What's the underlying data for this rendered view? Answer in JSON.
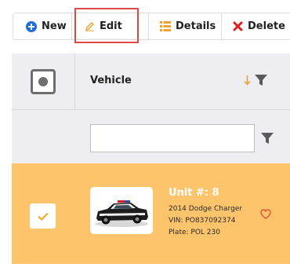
{
  "toolbar": {
    "new_label": "New",
    "edit_label": "Edit",
    "details_label": "Details",
    "delete_label": "Delete",
    "highlighted": "edit"
  },
  "grid": {
    "column_title": "Vehicle",
    "sort_direction": "descending",
    "filter_value": "",
    "filter_placeholder": "",
    "rows": [
      {
        "selected": true,
        "unit": "Unit #: 8",
        "model": "2014 Dodge Charger",
        "vin": "VIN: PO837092374",
        "plate": "Plate: POL 230",
        "favorite": false
      }
    ]
  },
  "colors": {
    "selected_row": "#fdc46b",
    "header_bg": "#eeeef2",
    "new_icon": "#1e6fd9",
    "edit_icon": "#f0a030",
    "details_icon": "#f0a030",
    "delete_icon": "#e02020",
    "highlight_border": "#e04848"
  },
  "icons": {
    "new": "plus-circle-icon",
    "edit": "pencil-icon",
    "details": "list-icon",
    "delete": "x-icon",
    "sort": "arrow-down-icon",
    "filter": "funnel-icon",
    "favorite": "heart-outline-icon"
  }
}
